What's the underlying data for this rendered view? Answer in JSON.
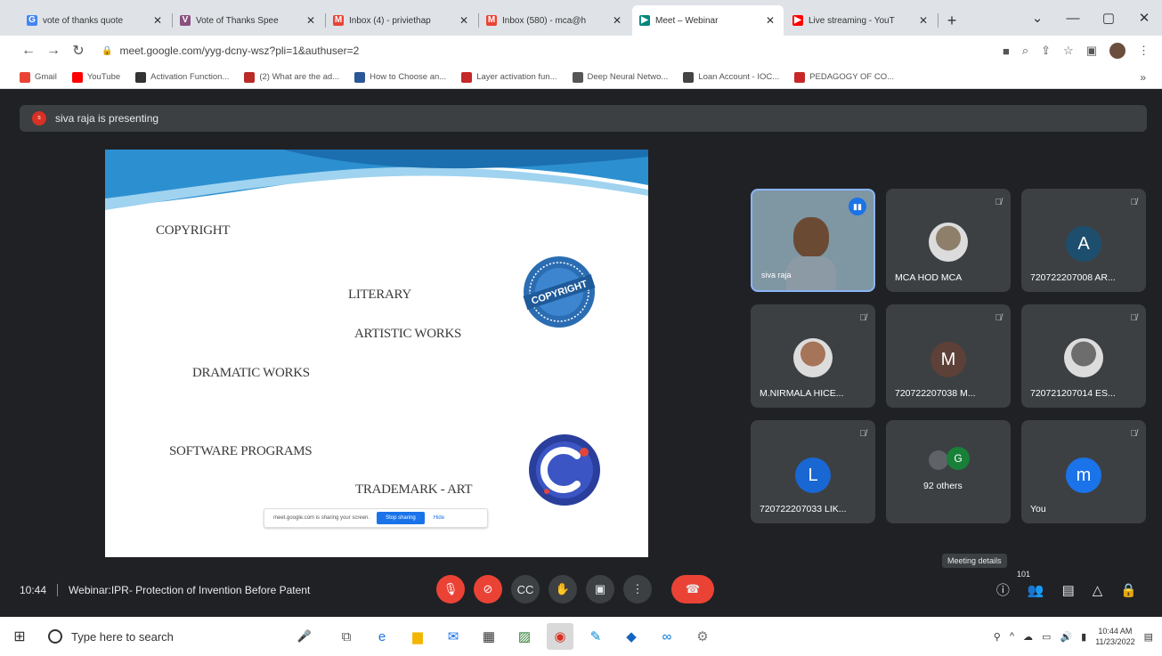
{
  "browser": {
    "tabs": [
      {
        "title": "vote of thanks quote",
        "icon": "google-icon",
        "color": "#4285f4",
        "glyph": "G"
      },
      {
        "title": "Vote of Thanks Spee",
        "icon": "slides-icon",
        "color": "#8a4f7d",
        "glyph": "V"
      },
      {
        "title": "Inbox (4) - priviethap",
        "icon": "gmail-icon",
        "color": "#ea4335",
        "glyph": "M"
      },
      {
        "title": "Inbox (580) - mca@h",
        "icon": "gmail-icon",
        "color": "#ea4335",
        "glyph": "M"
      },
      {
        "title": "Meet – Webinar",
        "icon": "meet-icon",
        "color": "#00897b",
        "glyph": "▶"
      },
      {
        "title": "Live streaming - YouT",
        "icon": "youtube-icon",
        "color": "#ff0000",
        "glyph": "▶"
      }
    ],
    "new_tab": "+",
    "window_controls": {
      "dropdown": "⌄",
      "minimize": "—",
      "maximize": "▢",
      "close": "✕"
    },
    "url": "meet.google.com/yyg-dcny-wsz?pli=1&authuser=2",
    "bookmarks": [
      {
        "label": "Gmail",
        "color": "#ea4335"
      },
      {
        "label": "YouTube",
        "color": "#ff0000"
      },
      {
        "label": "Activation Function...",
        "color": "#333333"
      },
      {
        "label": "(2) What are the ad...",
        "color": "#b92b27"
      },
      {
        "label": "How to Choose an...",
        "color": "#2b5797"
      },
      {
        "label": "Layer activation fun...",
        "color": "#c62828"
      },
      {
        "label": "Deep Neural Netwo...",
        "color": "#555555"
      },
      {
        "label": "Loan Account - IOC...",
        "color": "#444444"
      },
      {
        "label": "PEDAGOGY OF CO...",
        "color": "#c62828"
      }
    ],
    "bookmarks_more": "»"
  },
  "meet": {
    "presenter_initial": "s",
    "presenting_text": "siva raja is presenting",
    "slide": {
      "items": [
        "COPYRIGHT",
        "LITERARY",
        "ARTISTIC WORKS",
        "DRAMATIC WORKS",
        "SOFTWARE PROGRAMS",
        "TRADEMARK - ART"
      ],
      "seal_text": "COPYRIGHT",
      "toast": {
        "message": "meet.google.com is sharing your screen.",
        "stop": "Stop sharing",
        "hide": "Hide"
      }
    },
    "participants": [
      {
        "name": "siva raja",
        "type": "video",
        "speaking": true
      },
      {
        "name": "MCA HOD MCA",
        "type": "photo",
        "color": "#8d7f6a"
      },
      {
        "name": "720722207008 AR...",
        "type": "letter",
        "letter": "A",
        "color": "#1e4e6e"
      },
      {
        "name": "M.NIRMALA HICE...",
        "type": "photo",
        "color": "#a67458"
      },
      {
        "name": "720722207038 M...",
        "type": "letter",
        "letter": "M",
        "color": "#5d4037"
      },
      {
        "name": "720721207014 ES...",
        "type": "photo",
        "color": "#6d6d6d"
      },
      {
        "name": "720722207033 LIK...",
        "type": "letter",
        "letter": "L",
        "color": "#1967d2"
      },
      {
        "name": "92 others",
        "type": "others",
        "letter": "G",
        "color": "#188038"
      },
      {
        "name": "You",
        "type": "letter",
        "letter": "m",
        "color": "#1a73e8"
      }
    ],
    "tooltip": "Meeting details",
    "time": "10:44",
    "meeting_title": "Webinar:IPR- Protection of Invention Before Patent",
    "people_count": "101"
  },
  "taskbar": {
    "search_placeholder": "Type here to search",
    "time": "10:44 AM",
    "date": "11/23/2022"
  }
}
